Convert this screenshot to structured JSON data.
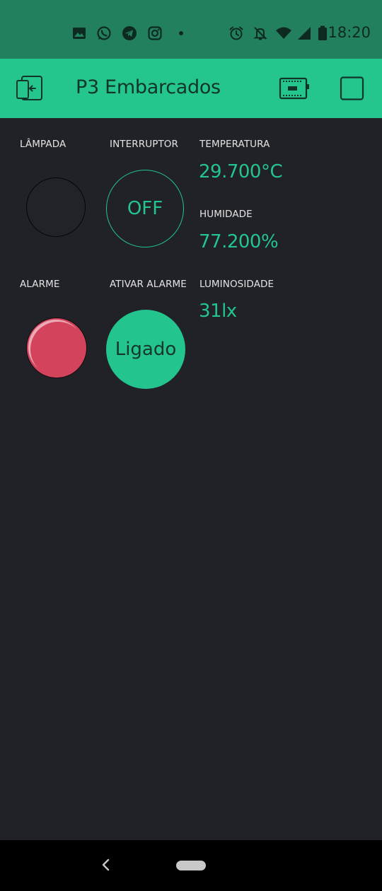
{
  "status_bar": {
    "time": "18:20",
    "notification_icons": [
      "gallery-icon",
      "whatsapp-icon",
      "telegram-icon",
      "instagram-icon",
      "dot-icon"
    ],
    "system_icons": [
      "alarm-icon",
      "notifications-off-icon",
      "wifi-icon",
      "signal-icon",
      "battery-icon"
    ]
  },
  "app_bar": {
    "title": "P3 Embarcados",
    "left_icon": "exit-icon",
    "right_icons": [
      "device-icon",
      "square-icon"
    ]
  },
  "widgets": {
    "lampada": {
      "label": "LÂMPADA",
      "state": "off"
    },
    "interruptor": {
      "label": "INTERRUPTOR",
      "button_text": "OFF"
    },
    "temperatura": {
      "label": "TEMPERATURA",
      "value": "29.700°C"
    },
    "humidade": {
      "label": "HUMIDADE",
      "value": "77.200%"
    },
    "alarme": {
      "label": "ALARME",
      "state": "on"
    },
    "ativar_alarme": {
      "label": "ATIVAR ALARME",
      "button_text": "Ligado"
    },
    "luminosidade": {
      "label": "LUMINOSIDADE",
      "value": "31lx"
    }
  },
  "colors": {
    "status_bar": "#23805f",
    "app_bar": "#24c68d",
    "background": "#212227",
    "accent": "#23c48e",
    "alarm_led": "#d3435c"
  },
  "nav_bar": {
    "icons": [
      "back-icon",
      "home-pill"
    ]
  }
}
